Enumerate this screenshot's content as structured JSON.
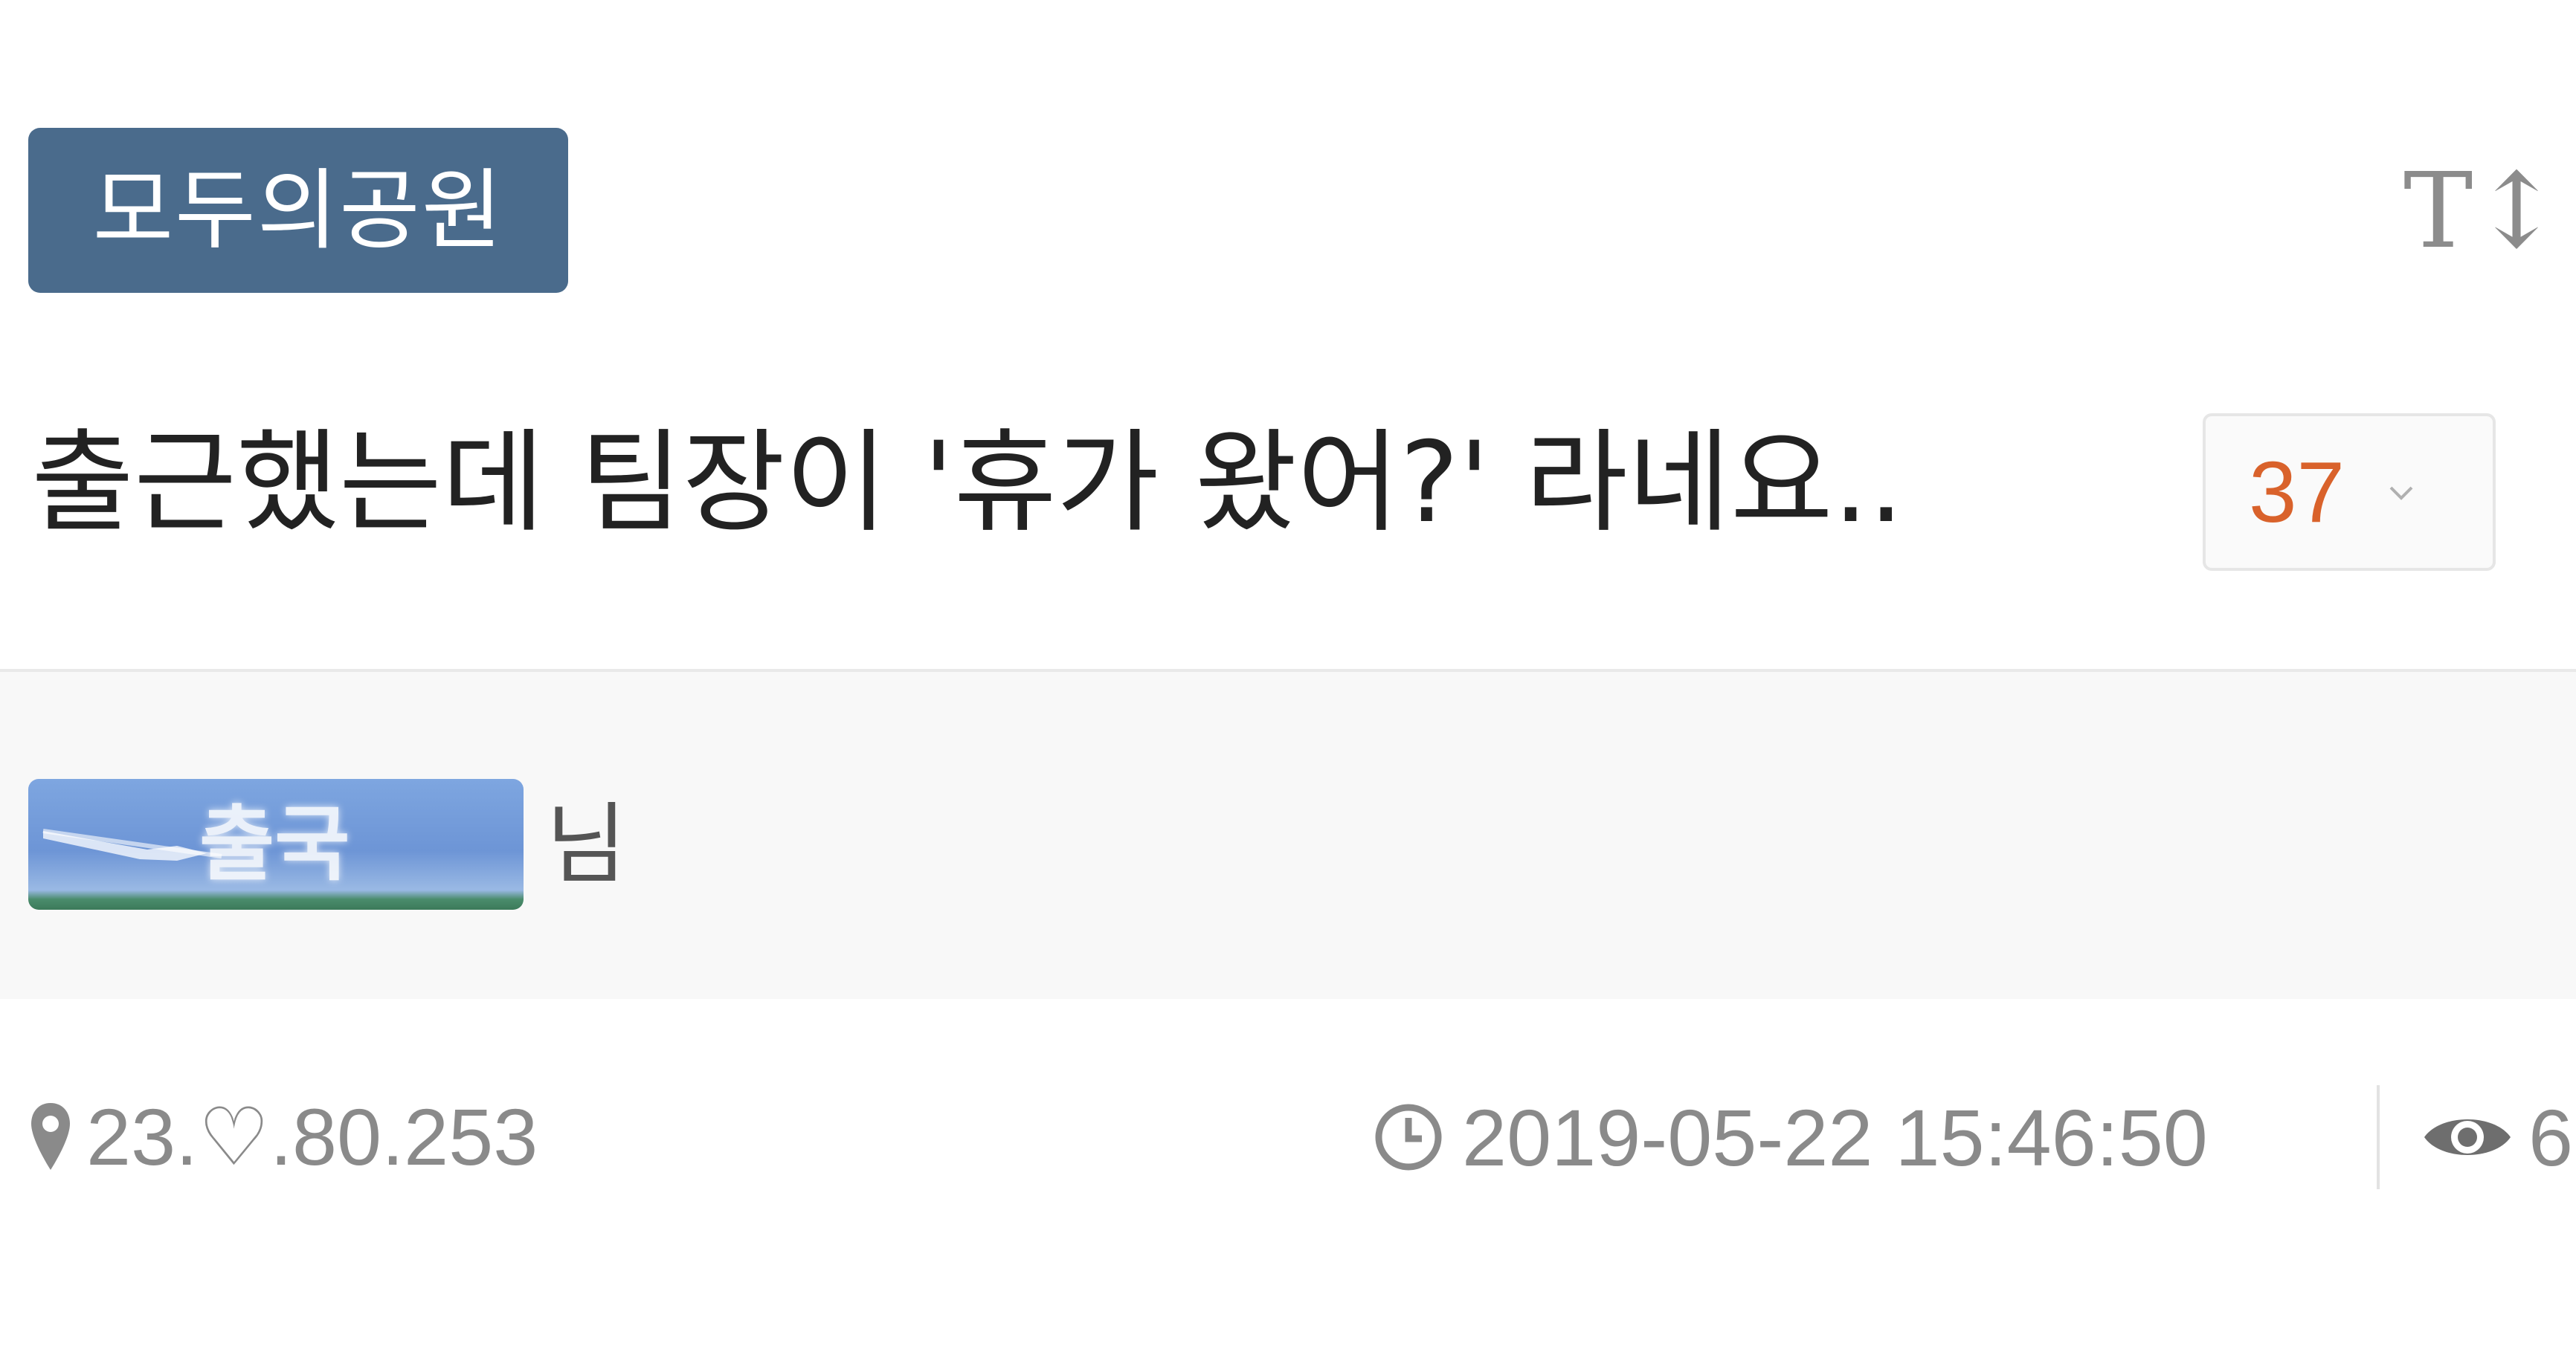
{
  "post": {
    "board_name": "모두의공원",
    "title": "출근했는데 팀장이 '휴가 왔어?' 라네요..",
    "comment_count": "37",
    "font_size_label": "T↕"
  },
  "author": {
    "badge_text": "출국",
    "suffix": "님"
  },
  "meta": {
    "ip": "23.♡.80.253",
    "datetime": "2019-05-22 15:46:50",
    "views": "6"
  },
  "colors": {
    "board_tag_bg": "#4a6b8c",
    "comment_count_text": "#d9622b",
    "meta_text": "#8a8a8a"
  },
  "icons": [
    "map-pin-icon",
    "clock-icon",
    "eye-icon",
    "chevron-down-icon",
    "font-size-icon",
    "airplane-icon"
  ]
}
